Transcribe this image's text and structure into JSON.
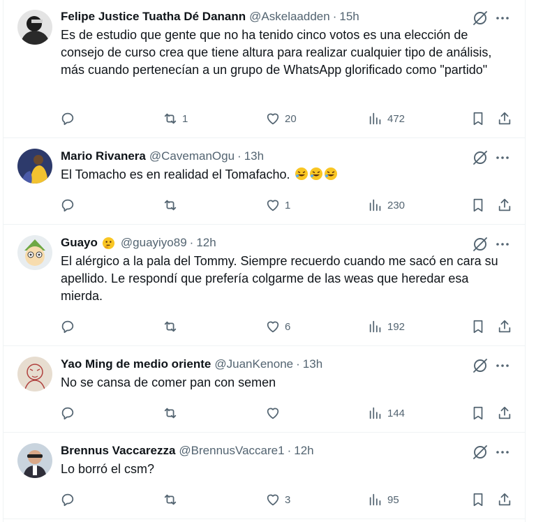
{
  "tweets": [
    {
      "name": "Felipe Justice Tuatha Dé Danann",
      "handle": "@Askelaadden",
      "time": "15h",
      "text": "Es de estudio que gente que no ha tenido cinco votos es una elección de consejo de curso crea que tiene altura para realizar cualquier tipo de análisis, más cuando pertenecían a un grupo de WhatsApp glorificado como \"partido\"",
      "replies": "",
      "reposts": "1",
      "likes": "20",
      "views": "472",
      "avatar_icon": "avatar-dark-figure"
    },
    {
      "name": "Mario Rivanera",
      "handle": "@CavemanOgu",
      "time": "13h",
      "text": "El Tomacho es en realidad el Tomafacho.",
      "text_emoji": "rolling-on-floor-laughing x3",
      "replies": "",
      "reposts": "",
      "likes": "1",
      "views": "230",
      "avatar_icon": "avatar-yellow-figure"
    },
    {
      "name": "Guayo",
      "name_emoji": "thinking-face",
      "handle": "@guayiyo89",
      "time": "12h",
      "text": "El alérgico a la pala del Tommy. Siempre recuerdo cuando me sacó en cara su apellido. Le respondí que prefería colgarme de las weas que heredar esa mierda.",
      "replies": "",
      "reposts": "",
      "likes": "6",
      "views": "192",
      "avatar_icon": "avatar-cartoon"
    },
    {
      "name": "Yao Ming de medio oriente",
      "handle": "@JuanKenone",
      "time": "13h",
      "text": "No se cansa de comer pan con semen",
      "replies": "",
      "reposts": "",
      "likes": "",
      "views": "144",
      "avatar_icon": "avatar-sketch"
    },
    {
      "name": "Brennus Vaccarezza",
      "handle": "@BrennusVaccare1",
      "time": "12h",
      "text": "Lo borró el csm?",
      "replies": "",
      "reposts": "",
      "likes": "3",
      "views": "95",
      "avatar_icon": "avatar-photo-man"
    }
  ],
  "icons": {
    "reply": "reply-icon",
    "repost": "repost-icon",
    "like": "heart-icon",
    "views": "analytics-icon",
    "bookmark": "bookmark-icon",
    "share": "share-icon",
    "grok": "grok-icon",
    "more": "more-icon"
  },
  "colors": {
    "text": "#0f1419",
    "secondary": "#536471",
    "border": "#eff3f4"
  }
}
